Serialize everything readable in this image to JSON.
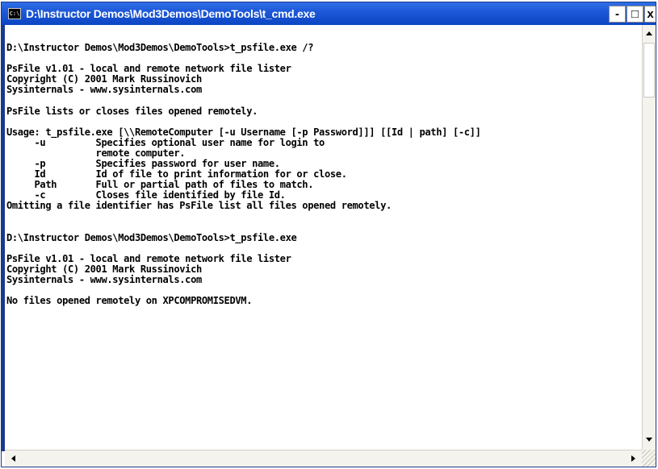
{
  "window": {
    "title": "D:\\Instructor Demos\\Mod3Demos\\DemoTools\\t_cmd.exe",
    "icon": "console-icon",
    "icon_text": "C:\\",
    "controls": {
      "minimize": "-",
      "maximize": "□",
      "close": "x"
    }
  },
  "console": {
    "lines": [
      "D:\\Instructor Demos\\Mod3Demos\\DemoTools>t_psfile.exe /?",
      "",
      "PsFile v1.01 - local and remote network file lister",
      "Copyright (C) 2001 Mark Russinovich",
      "Sysinternals - www.sysinternals.com",
      "",
      "PsFile lists or closes files opened remotely.",
      "",
      "Usage: t_psfile.exe [\\\\RemoteComputer [-u Username [-p Password]]] [[Id | path] [-c]]",
      "     -u         Specifies optional user name for login to",
      "                remote computer.",
      "     -p         Specifies password for user name.",
      "     Id         Id of file to print information for or close.",
      "     Path       Full or partial path of files to match.",
      "     -c         Closes file identified by file Id.",
      "Omitting a file identifier has PsFile list all files opened remotely.",
      "",
      "",
      "D:\\Instructor Demos\\Mod3Demos\\DemoTools>t_psfile.exe",
      "",
      "PsFile v1.01 - local and remote network file lister",
      "Copyright (C) 2001 Mark Russinovich",
      "Sysinternals - www.sysinternals.com",
      "",
      "No files opened remotely on XPCOMPROMISEDVM."
    ]
  },
  "colors": {
    "titlebar": "#0b45c4",
    "console_bg": "#ffffff",
    "console_text": "#000000",
    "frame": "#1a3a8a"
  }
}
